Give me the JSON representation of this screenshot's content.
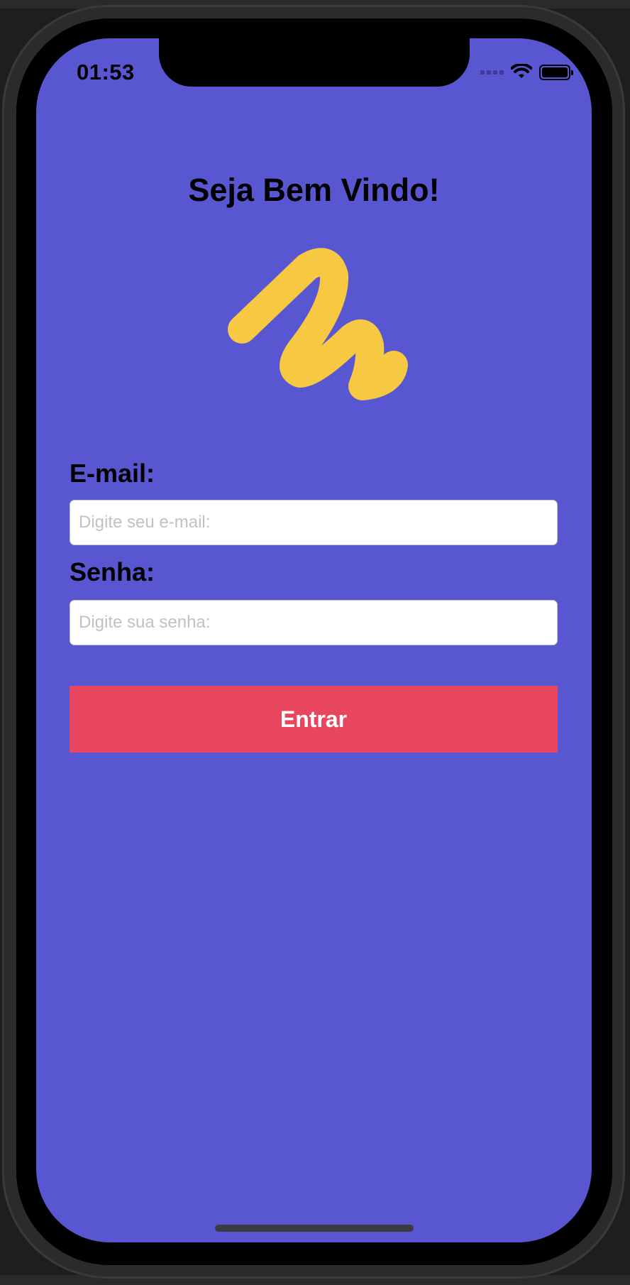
{
  "status_bar": {
    "time": "01:53"
  },
  "login": {
    "title": "Seja Bem Vindo!",
    "email_label": "E-mail:",
    "email_placeholder": "Digite seu e-mail:",
    "email_value": "",
    "password_label": "Senha:",
    "password_placeholder": "Digite sua senha:",
    "password_value": "",
    "submit_label": "Entrar"
  },
  "colors": {
    "background": "#5856d0",
    "accent_button": "#e8465e",
    "logo": "#f7c842"
  },
  "icons": {
    "logo": "yellow-squiggle-logo",
    "wifi": "wifi-icon",
    "battery": "battery-icon",
    "signal": "cellular-signal-icon"
  }
}
